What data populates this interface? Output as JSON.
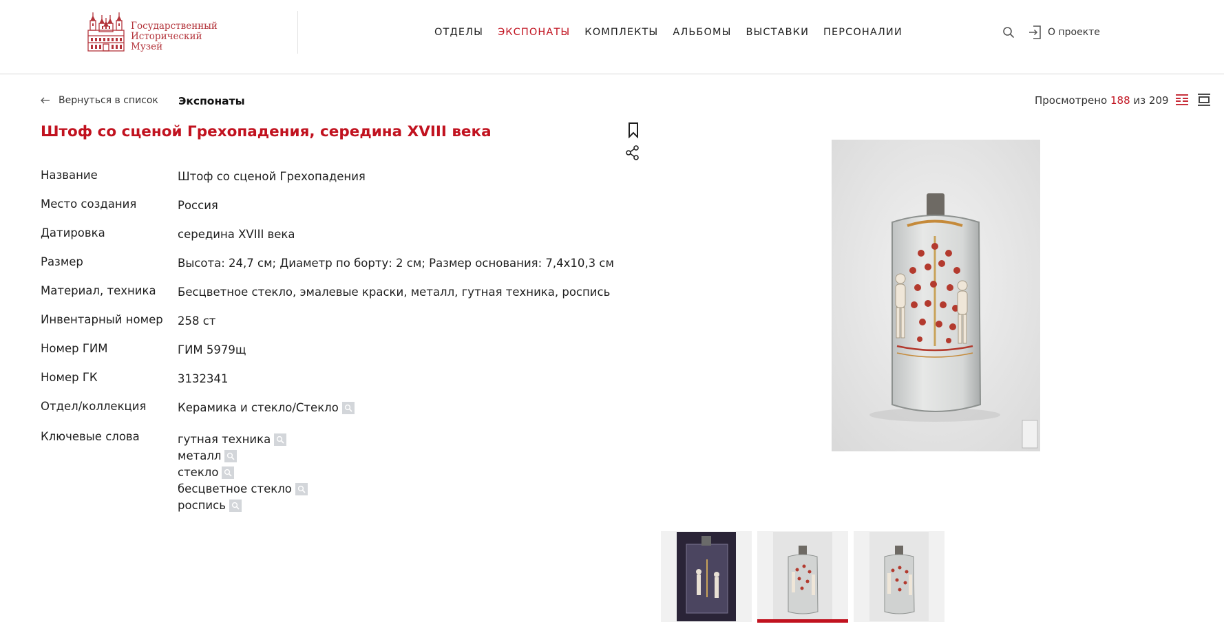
{
  "header": {
    "logo": {
      "line1": "Государственный",
      "line2": "Исторический",
      "line3": "Музей"
    },
    "nav": [
      {
        "label": "ОТДЕЛЫ",
        "active": false
      },
      {
        "label": "ЭКСПОНАТЫ",
        "active": true
      },
      {
        "label": "КОМПЛЕКТЫ",
        "active": false
      },
      {
        "label": "АЛЬБОМЫ",
        "active": false
      },
      {
        "label": "ВЫСТАВКИ",
        "active": false
      },
      {
        "label": "ПЕРСОНАЛИИ",
        "active": false
      }
    ],
    "search_icon": "search-icon",
    "about_label": "О проекте",
    "about_icon": "login-icon"
  },
  "subbar": {
    "back_label": "Вернуться в список",
    "breadcrumb": "Экспонаты",
    "viewed_prefix": "Просмотрено",
    "viewed_current": "188",
    "viewed_sep": "из",
    "viewed_total": "209"
  },
  "object": {
    "title": "Штоф со сценой Грехопадения, середина XVIII века",
    "fields": [
      {
        "label": "Название",
        "value": "Штоф со сценой Грехопадения"
      },
      {
        "label": "Место создания",
        "value": "Россия"
      },
      {
        "label": "Датировка",
        "value": "середина XVIII века"
      },
      {
        "label": "Размер",
        "value": "Высота: 24,7 см; Диаметр по борту: 2 см; Размер основания: 7,4х10,3 см"
      },
      {
        "label": "Материал, техника",
        "value": "Бесцветное стекло, эмалевые краски, металл, гутная техника, роспись"
      },
      {
        "label": "Инвентарный номер",
        "value": "258 ст"
      },
      {
        "label": "Номер ГИМ",
        "value": "ГИМ 5979щ"
      },
      {
        "label": "Номер ГК",
        "value": "3132341"
      }
    ],
    "collection": {
      "label": "Отдел/коллекция",
      "value": "Керамика и стекло/Стекло"
    },
    "keywords": {
      "label": "Ключевые слова",
      "items": [
        "гутная техника",
        "металл",
        "стекло",
        "бесцветное стекло",
        "роспись"
      ]
    }
  },
  "colors": {
    "accent": "#c1121f",
    "logo": "#b3343b",
    "text": "#1f1f1f"
  }
}
